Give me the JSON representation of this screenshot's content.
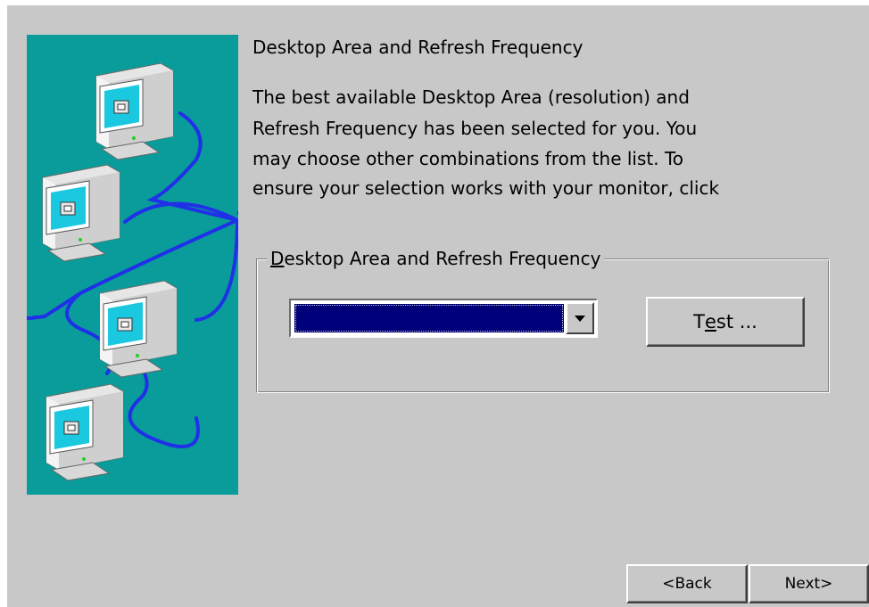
{
  "heading": "Desktop Area and Refresh Frequency",
  "description_lines": [
    "The best available Desktop Area (resolution) and",
    "Refresh Frequency has been selected for you.  You",
    "may choose other combinations from the list.  To",
    "ensure your selection works with your monitor, click"
  ],
  "group": {
    "legend_prefix": "",
    "legend_accel": "D",
    "legend_rest": "esktop Area and Refresh Frequency"
  },
  "combo": {
    "selected_value": ""
  },
  "test_button": {
    "prefix": "T",
    "accel": "e",
    "rest": "st ..."
  },
  "nav": {
    "back_label": "<Back",
    "next_label": "Next>"
  },
  "colors": {
    "dialog_bg": "#c8c8c8",
    "art_bg": "#0a9c9a",
    "cable": "#2030e8",
    "selection": "#00007b"
  },
  "icons": {
    "side_art": "networked-monitors-illustration",
    "combo_arrow": "chevron-down-icon"
  }
}
